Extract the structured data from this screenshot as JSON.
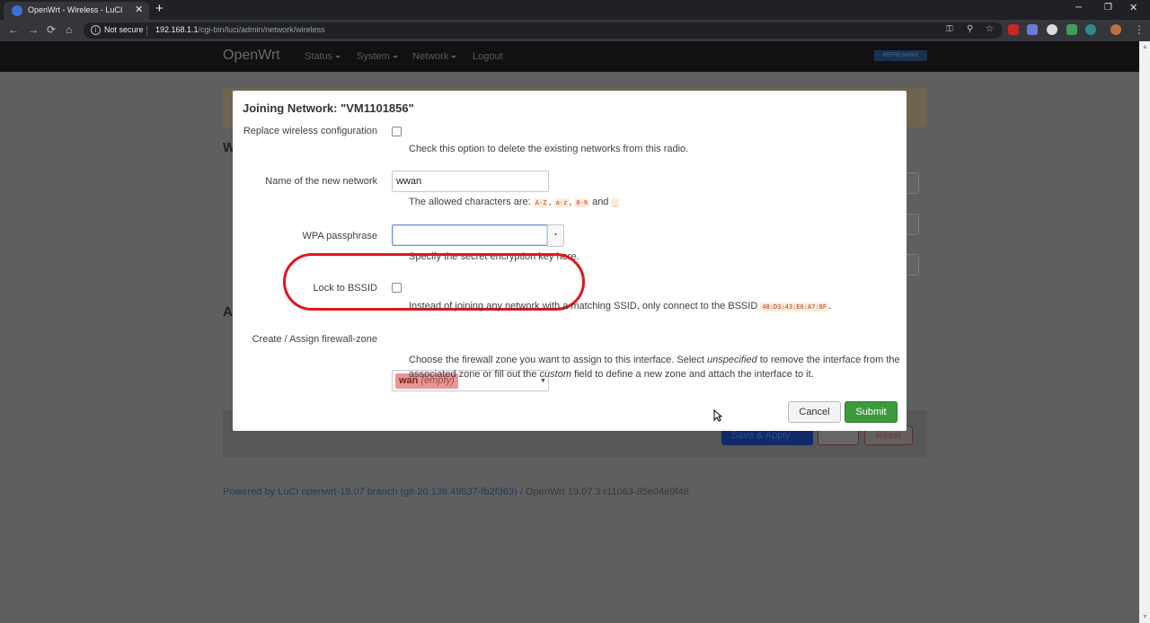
{
  "browser": {
    "tab_title": "OpenWrt - Wireless - LuCI",
    "tab_close": "✕",
    "new_tab": "+",
    "win_min": "─",
    "win_restore": "❐",
    "win_close": "✕",
    "back": "←",
    "forward": "→",
    "reload": "⟳",
    "home": "⌂",
    "security_icon": "i",
    "security_label": "Not secure",
    "url_host": "192.168.1.1",
    "url_path": "/cgi-bin/luci/admin/network/wireless",
    "key_icon": "⚿",
    "zoom_icon": "⚲",
    "star_icon": "☆",
    "menu_icon": "⋮"
  },
  "luci": {
    "brand": "OpenWrt",
    "menu": [
      "Status",
      "System",
      "Network",
      "Logout"
    ],
    "refresh_badge": "REFRESHING"
  },
  "background": {
    "section_letter_1": "W",
    "section_letter_2": "A",
    "save_apply": "Save & Apply",
    "save": "Save",
    "reset": "Reset",
    "powered_by": "Powered by LuCI openwrt-19.07 branch (git-20.136.49537-fb2f363)",
    "version": " / OpenWrt 19.07.3 r11063-85e04e9f46"
  },
  "modal": {
    "title": "Joining Network: \"VM1101856\"",
    "replace": {
      "label": "Replace wireless configuration",
      "help": "Check this option to delete the existing networks from this radio."
    },
    "name": {
      "label": "Name of the new network",
      "value": "wwan",
      "help_prefix": "The allowed characters are: ",
      "code1": "A-Z",
      "code2": "a-z",
      "code3": "0-9",
      "code4": "_",
      "sep": ", ",
      "and": " and "
    },
    "wpa": {
      "label": "WPA passphrase",
      "value": "",
      "reveal": "▪",
      "help": "Specify the secret encryption key here."
    },
    "bssid": {
      "label": "Lock to BSSID",
      "help": "Instead of joining any network with a matching SSID, only connect to the BSSID ",
      "code": "48:D3:43:E6:A7:8F",
      "end": "."
    },
    "firewall": {
      "label": "Create / Assign firewall-zone",
      "zone": "wan",
      "zone_note": "(empty)",
      "caret": "▼",
      "help_line1_a": "Choose the firewall zone you want to assign to this interface. Select ",
      "help_line1_em": "unspecified",
      "help_line1_b": " to remove the interface from the",
      "help_line2_a": "associated zone or fill out the ",
      "help_line2_em": "custom",
      "help_line2_b": " field to define a new zone and attach the interface to it."
    },
    "cancel": "Cancel",
    "submit": "Submit"
  },
  "colors": {
    "submit": "#3c9a3c",
    "highlight": "#e3141e",
    "zone": "#e89696"
  }
}
